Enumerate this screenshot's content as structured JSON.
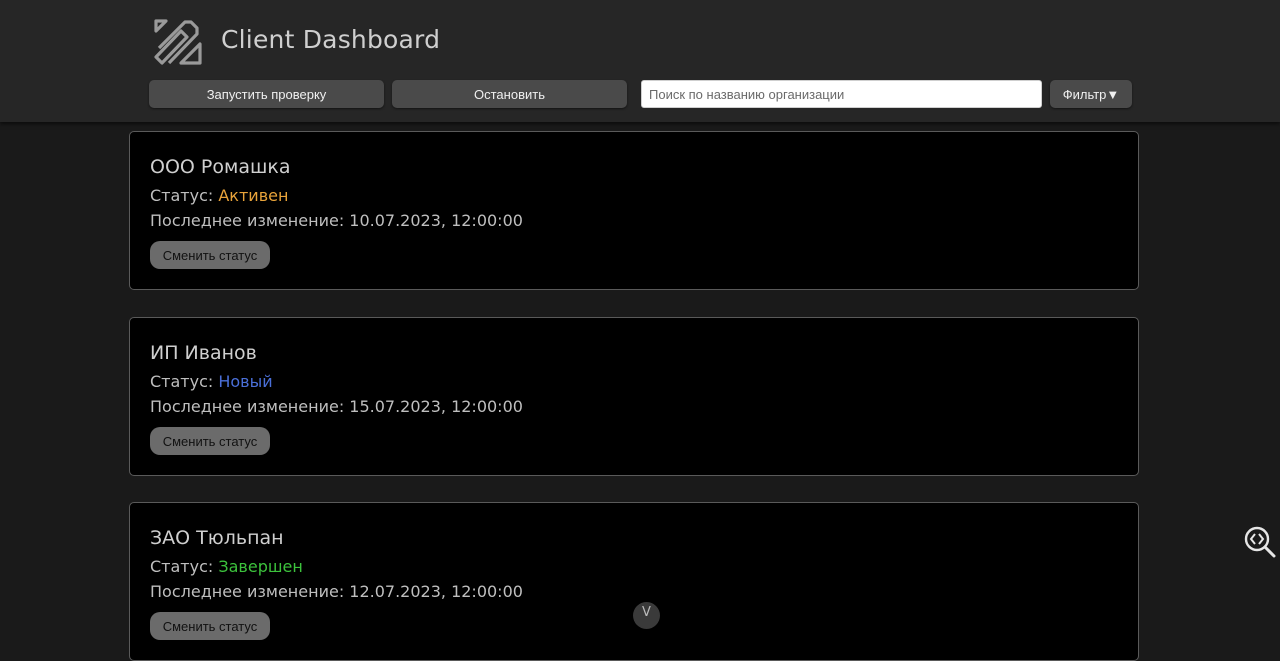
{
  "header": {
    "title": "Client Dashboard",
    "logo_icon": "paperclip-logo-icon",
    "start_label": "Запустить проверку",
    "stop_label": "Остановить",
    "filter_label": "Фильтр▼",
    "search": {
      "value": "",
      "placeholder": "Поиск по названию организации"
    }
  },
  "status_colors": {
    "active": "#e8a33a",
    "new": "#4a6fd8",
    "done": "#3cc23c"
  },
  "clients": [
    {
      "name": "ООО Ромашка",
      "status_label": "Статус: ",
      "status": "Активен",
      "status_color": "#e8a33a",
      "changed": "Последнее изменение: 10.07.2023, 12:00:00",
      "button_label": "Сменить статус"
    },
    {
      "name": "ИП Иванов",
      "status_label": "Статус: ",
      "status": "Новый",
      "status_color": "#4a6fd8",
      "changed": "Последнее изменение: 15.07.2023, 12:00:00",
      "button_label": "Сменить статус"
    },
    {
      "name": "ЗАО Тюльпан",
      "status_label": "Статус: ",
      "status": "Завершен",
      "status_color": "#3cc23c",
      "changed": "Последнее изменение: 12.07.2023, 12:00:00",
      "button_label": "Сменить статус"
    }
  ],
  "floating": {
    "inspect_icon": "code-search-icon",
    "scroll_icon": "chevron-down-icon",
    "scroll_glyph": "V"
  }
}
